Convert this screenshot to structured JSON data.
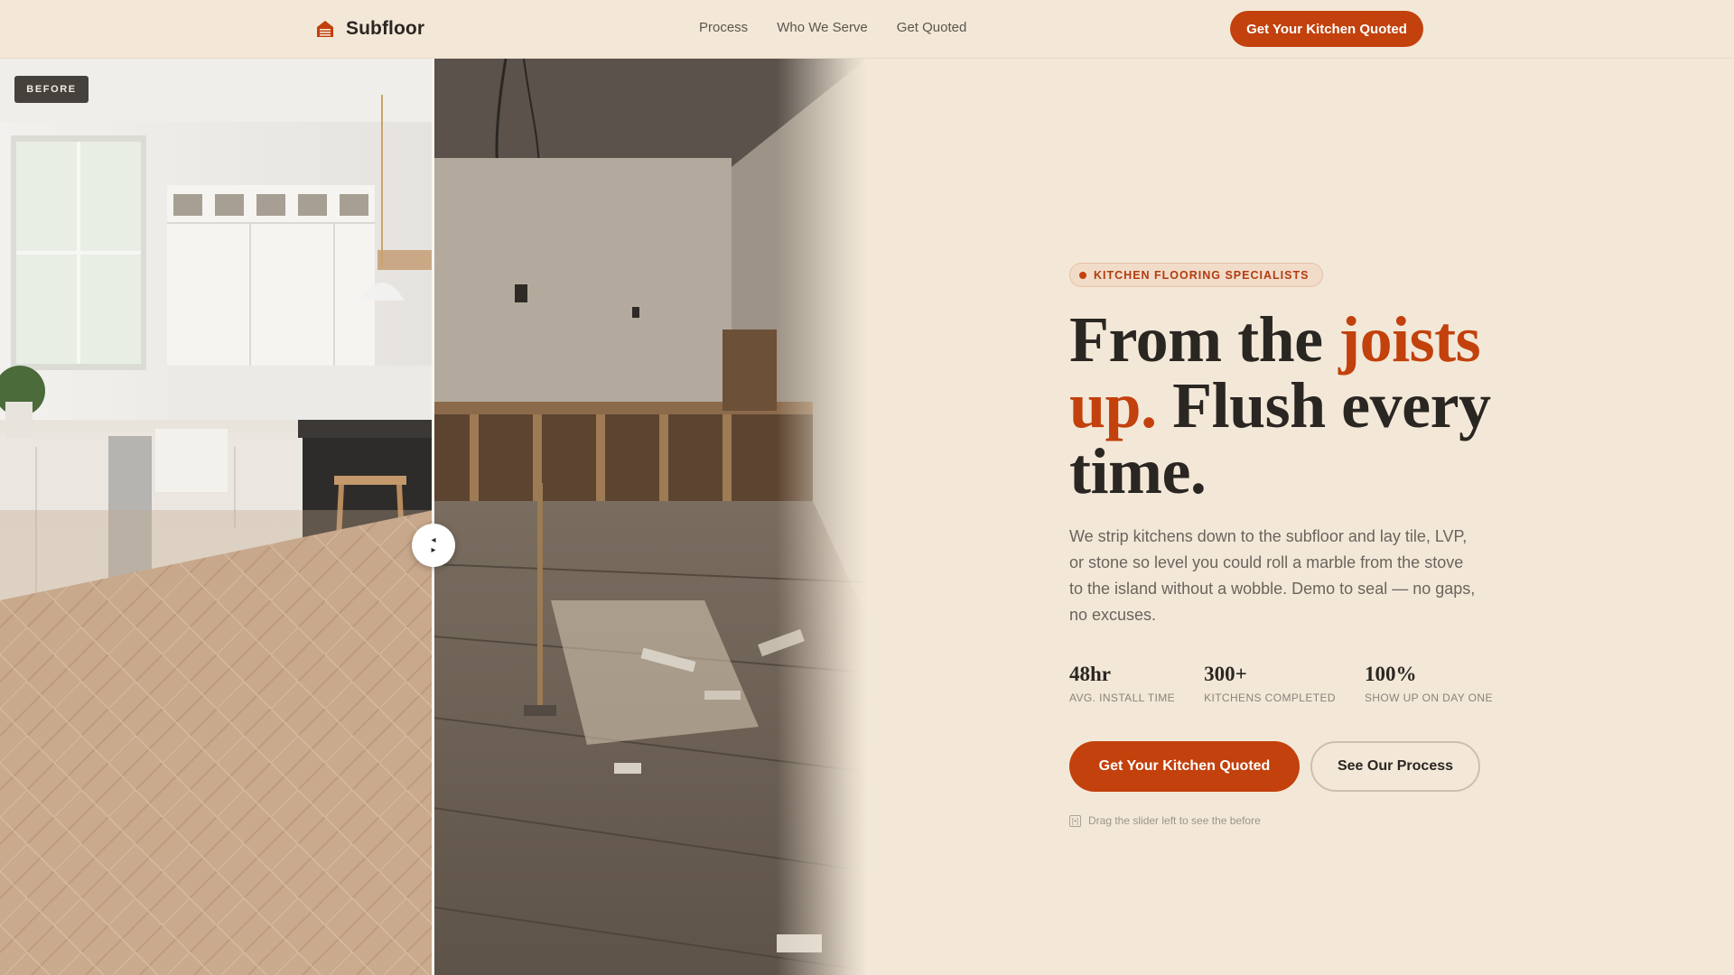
{
  "nav": {
    "brand": "Subfloor",
    "links": [
      "Process",
      "Who We Serve",
      "Get Quoted"
    ],
    "cta": "Get Your Kitchen Quoted"
  },
  "comparison": {
    "before_label": "BEFORE",
    "handle_left": "◂",
    "handle_right": "▸",
    "slider_position_percent": 50
  },
  "hero": {
    "eyebrow": "KITCHEN FLOORING SPECIALISTS",
    "headline": {
      "part1": "From the ",
      "accent": "joists up.",
      "part2": " Flush every time."
    },
    "body": "We strip kitchens down to the subfloor and lay tile, LVP, or stone so level you could roll a marble from the stove to the island without a wobble. Demo to seal — no gaps, no excuses.",
    "stats": [
      {
        "value": "48hr",
        "label": "AVG. INSTALL TIME"
      },
      {
        "value": "300+",
        "label": "KITCHENS COMPLETED"
      },
      {
        "value": "100%",
        "label": "SHOW UP ON DAY ONE"
      }
    ],
    "cta_primary": "Get Your Kitchen Quoted",
    "cta_secondary": "See Our Process",
    "hint_icon": "[•]",
    "hint": "Drag the slider left to see the before"
  },
  "colors": {
    "background": "#f3e8d8",
    "accent": "#c2410c",
    "text": "#2a2622",
    "muted": "#6b645c"
  }
}
